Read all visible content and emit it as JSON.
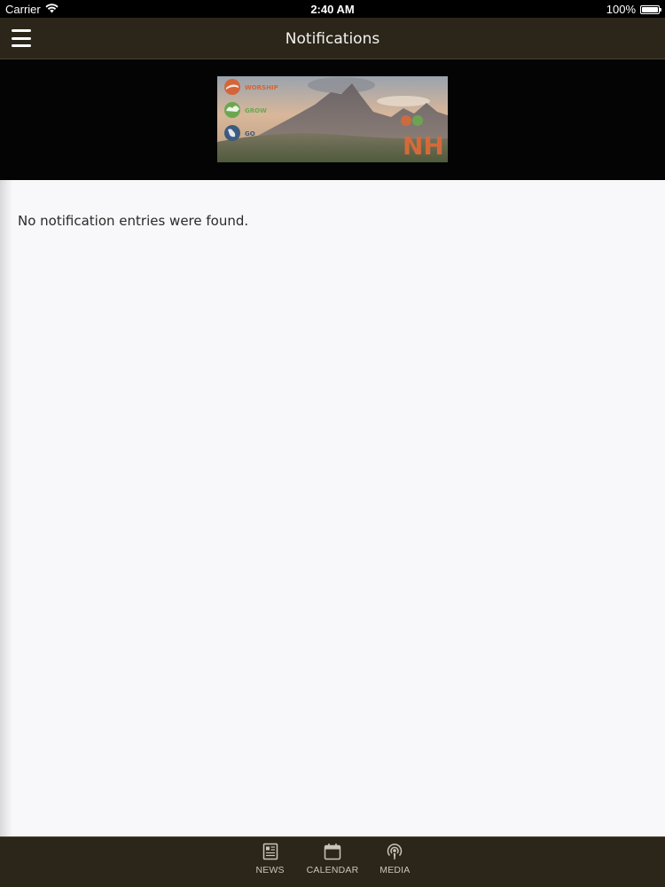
{
  "status_bar": {
    "carrier": "Carrier",
    "time": "2:40 AM",
    "battery_text": "100%",
    "battery_level": 1.0,
    "wifi_icon": "wifi-icon",
    "battery_icon": "battery-icon"
  },
  "nav": {
    "title": "Notifications",
    "menu_icon": "hamburger-menu-icon"
  },
  "banner": {
    "words": [
      "WORSHIP",
      "GROW",
      "GO"
    ],
    "logo_text": "NH",
    "colors": {
      "worship": "#d4653a",
      "grow": "#6aa84f",
      "go": "#3d5a80",
      "logo": "#d46a3a"
    }
  },
  "content": {
    "empty_message": "No notification entries were found."
  },
  "tabs": [
    {
      "label": "NEWS",
      "icon": "news-icon"
    },
    {
      "label": "CALENDAR",
      "icon": "calendar-icon"
    },
    {
      "label": "MEDIA",
      "icon": "podcast-icon"
    }
  ],
  "theme": {
    "bar_color": "#2b2619",
    "banner_bg": "#040404",
    "content_bg": "#f8f8fa"
  }
}
